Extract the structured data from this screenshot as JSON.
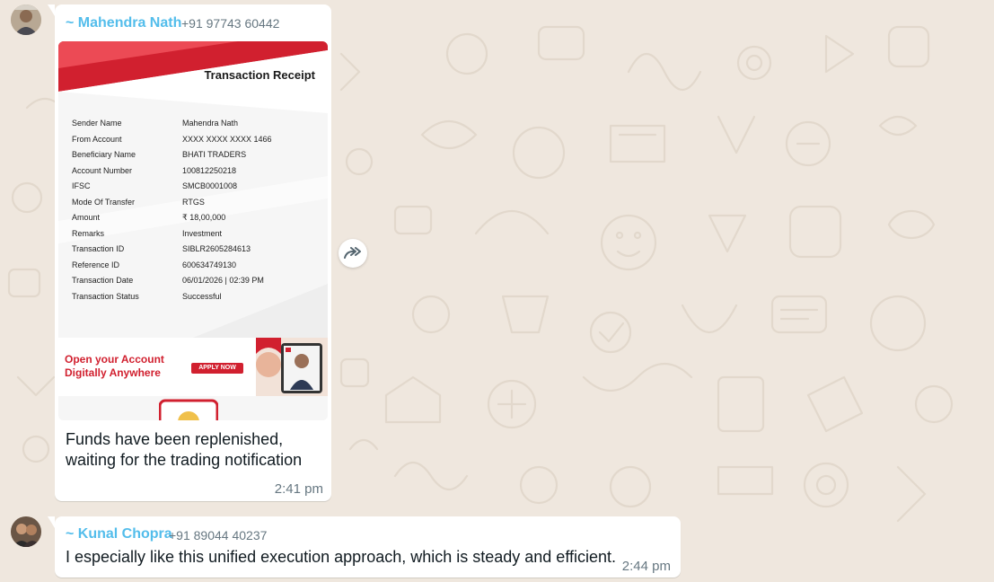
{
  "messages": [
    {
      "sender": "~ Mahendra Nath",
      "phone": "+91 97743 60442",
      "text_line1": "Funds have been replenished,",
      "text_line2": "waiting for the trading notification",
      "time": "2:41 pm",
      "receipt": {
        "title": "Transaction Receipt",
        "rows": [
          {
            "label": "Sender Name",
            "value": "Mahendra Nath"
          },
          {
            "label": "From Account",
            "value": "XXXX XXXX XXXX 1466"
          },
          {
            "label": "Beneficiary Name",
            "value": "BHATI TRADERS"
          },
          {
            "label": "Account Number",
            "value": "100812250218"
          },
          {
            "label": "IFSC",
            "value": "SMCB0001008"
          },
          {
            "label": "Mode Of Transfer",
            "value": "RTGS"
          },
          {
            "label": "Amount",
            "value": "₹ 18,00,000"
          },
          {
            "label": "Remarks",
            "value": "Investment"
          },
          {
            "label": "Transaction ID",
            "value": "SIBLR2605284613"
          },
          {
            "label": "Reference ID",
            "value": "600634749130"
          },
          {
            "label": "Transaction Date",
            "value": "06/01/2026 | 02:39 PM"
          },
          {
            "label": "Transaction Status",
            "value": "Successful"
          }
        ],
        "promo_line1": "Open your Account",
        "promo_line2": "Digitally Anywhere",
        "promo_button": "APPLY NOW"
      }
    },
    {
      "sender": "~ Kunal Chopra",
      "phone": "+91 89044 40237",
      "text": "I especially like this unified execution approach, which is steady and efficient.",
      "time": "2:44 pm"
    }
  ],
  "icons": {
    "forward": "forward-icon",
    "avatar": "avatar"
  },
  "colors": {
    "background": "#efe7de",
    "bubble": "#ffffff",
    "sender_name": "#53bdeb",
    "brand_red": "#d1202f"
  }
}
